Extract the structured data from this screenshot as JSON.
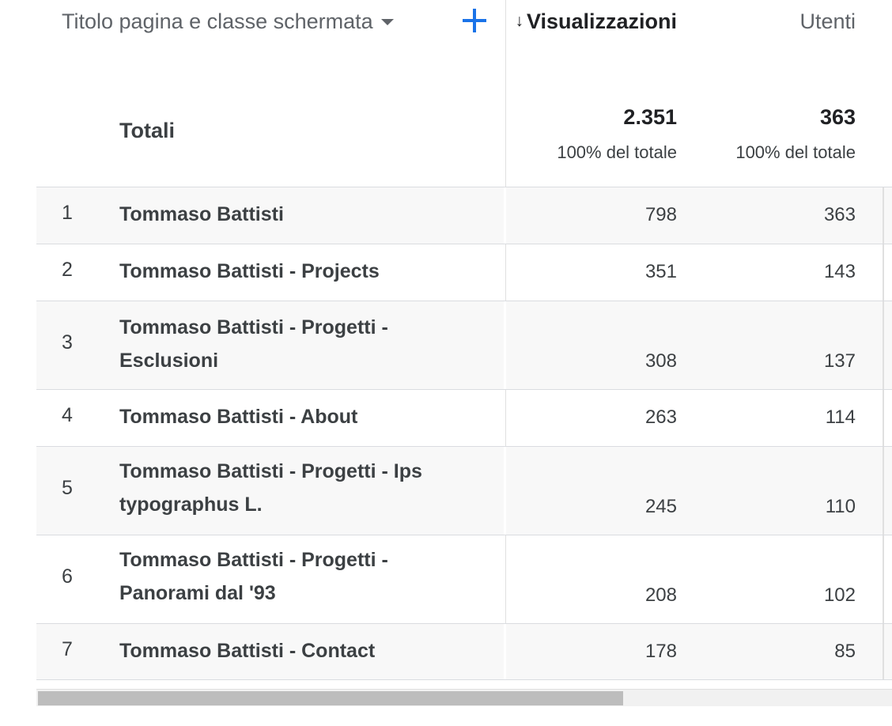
{
  "header": {
    "dimension_label": "Titolo pagina e classe schermata",
    "add_button_label": "+",
    "metrics": {
      "views": "Visualizzazioni",
      "users": "Utenti"
    },
    "sort_arrow": "↓"
  },
  "totals": {
    "label": "Totali",
    "views": "2.351",
    "views_pct": "100% del totale",
    "users": "363",
    "users_pct": "100% del totale"
  },
  "rows": [
    {
      "rank": "1",
      "title": "Tommaso Battisti",
      "views": "798",
      "users": "363"
    },
    {
      "rank": "2",
      "title": "Tommaso Battisti - Projects",
      "views": "351",
      "users": "143"
    },
    {
      "rank": "3",
      "title": "Tommaso Battisti - Progetti - Esclusioni",
      "views": "308",
      "users": "137"
    },
    {
      "rank": "4",
      "title": "Tommaso Battisti - About",
      "views": "263",
      "users": "114"
    },
    {
      "rank": "5",
      "title": "Tommaso Battisti - Progetti - Ips typographus L.",
      "views": "245",
      "users": "110"
    },
    {
      "rank": "6",
      "title": "Tommaso Battisti - Progetti - Panorami dal '93",
      "views": "208",
      "users": "102"
    },
    {
      "rank": "7",
      "title": "Tommaso Battisti - Contact",
      "views": "178",
      "users": "85"
    }
  ],
  "colors": {
    "accent": "#1a73e8",
    "row_shade": "#f8f8f8",
    "text": "#3c4043",
    "muted": "#5f6368"
  }
}
